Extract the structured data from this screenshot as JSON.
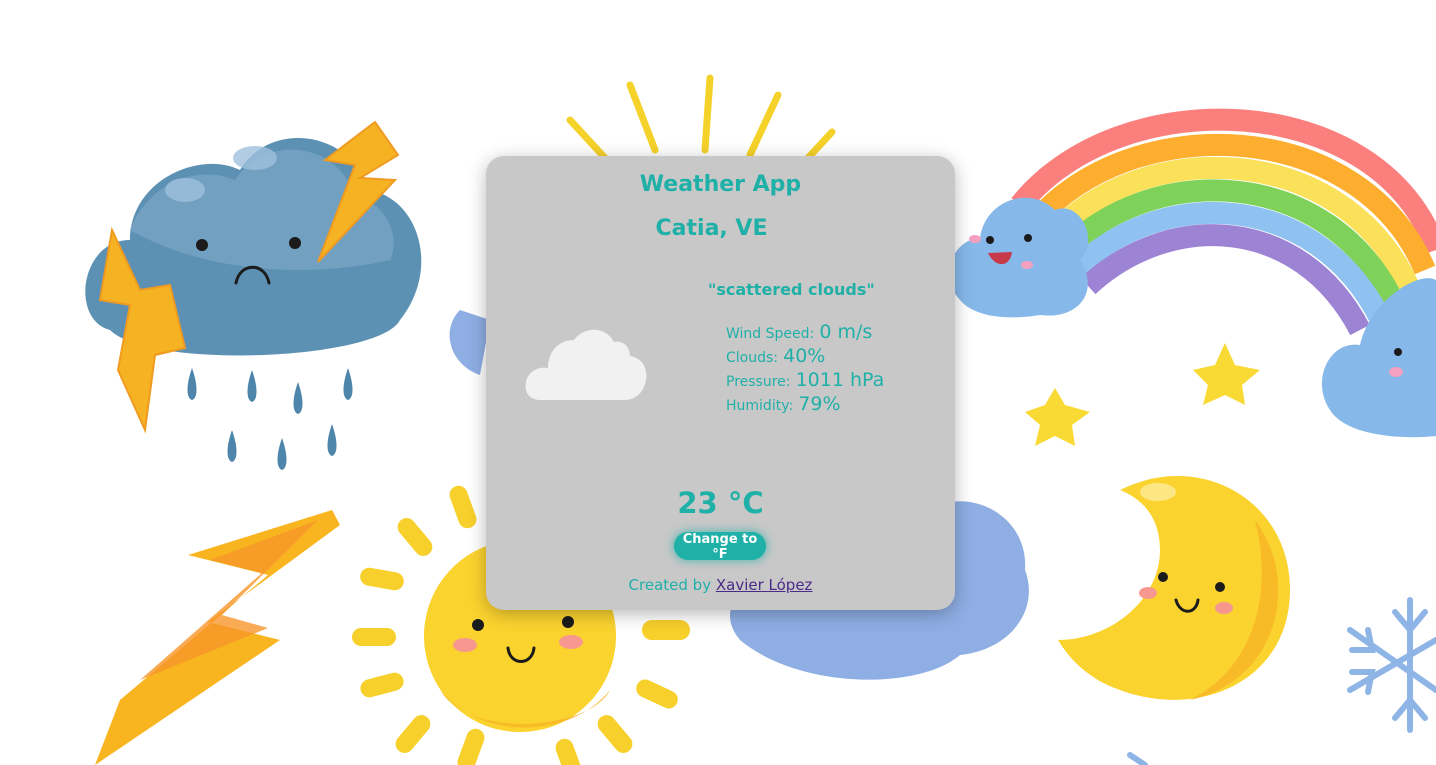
{
  "app": {
    "title": "Weather App",
    "location": "Catia, VE"
  },
  "weather": {
    "description": "\"scattered clouds\"",
    "icon": "cloud-icon",
    "details": [
      {
        "label": "Wind Speed:",
        "value": "0 m/s"
      },
      {
        "label": "Clouds:",
        "value": "40%"
      },
      {
        "label": "Pressure:",
        "value": "1011 hPa"
      },
      {
        "label": "Humidity:",
        "value": "79%"
      }
    ],
    "temperature": "23 °C"
  },
  "controls": {
    "unit_toggle_label": "Change to °F"
  },
  "footer": {
    "prefix": "Created by",
    "author": "Xavier López"
  },
  "colors": {
    "accent": "#1fb0a8",
    "card_background": "#c8c8c8",
    "link": "#4b2a86"
  },
  "background": {
    "illustrations": [
      "storm-cloud-icon",
      "lightning-bolt-icon",
      "sun-icon",
      "rainbow-icon",
      "happy-cloud-icon",
      "star-icon",
      "moon-icon",
      "snowflake-icon"
    ]
  }
}
